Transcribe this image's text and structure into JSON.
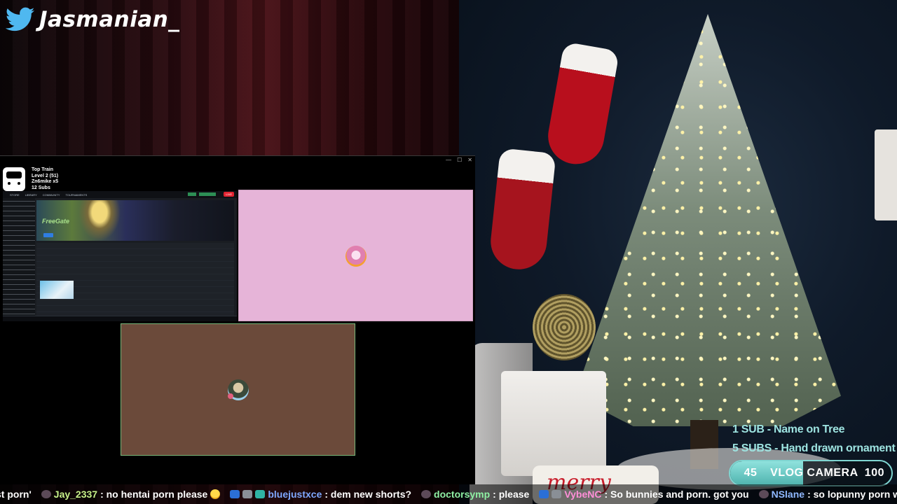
{
  "overlay": {
    "twitter_handle": "Jasmanian_"
  },
  "capture_window": {
    "controls": [
      "—",
      "☐",
      "✕"
    ],
    "train": {
      "title": "Top Train",
      "level": "Level 2  (51)",
      "user": "Zn6mike x5",
      "subs": "12 Subs"
    },
    "mini_app": {
      "nav": [
        "STORE",
        "LIBRARY",
        "COMMUNITY",
        "TOURNAMENTS"
      ],
      "live_label": "LIVE"
    }
  },
  "sub_goals": {
    "line1": "1 SUB - Name on Tree",
    "line2": "5 SUBS - Hand drawn ornament",
    "bar": {
      "current": "45",
      "label": "VLOG CAMERA",
      "target": "100",
      "progress_fraction": 0.45
    }
  },
  "chat": [
    {
      "user": "",
      "text": "st porn'",
      "user_color": "#ffffff",
      "badges": []
    },
    {
      "user": "Jay_2337",
      "text": ": no hentai porn please",
      "user_color": "#c7f28a",
      "badges": [
        "dark"
      ],
      "emoji": true
    },
    {
      "user": "bluejustxce",
      "text": ": dem new shorts?",
      "user_color": "#7fa8ff",
      "badges": [
        "blue",
        "grey",
        "teal"
      ]
    },
    {
      "user": "doctorsymp",
      "text": ": please",
      "user_color": "#8ff0a4",
      "badges": [
        "dark"
      ]
    },
    {
      "user": "VybeNC",
      "text": ": So bunnies and porn. got you",
      "user_color": "#ff8fd8",
      "badges": [
        "blue",
        "grey"
      ]
    },
    {
      "user": "NSlane",
      "text": ": so lopunny porn wow",
      "user_color": "#8fb8ff",
      "badges": [
        "dark"
      ]
    }
  ],
  "colors": {
    "goal_accent": "#7fd6d2",
    "pink_tile": "#e6b4d8",
    "brown_tile": "#6b4a3a"
  },
  "icons": {
    "handle": "twitter-bird-icon",
    "train": "train-icon"
  }
}
